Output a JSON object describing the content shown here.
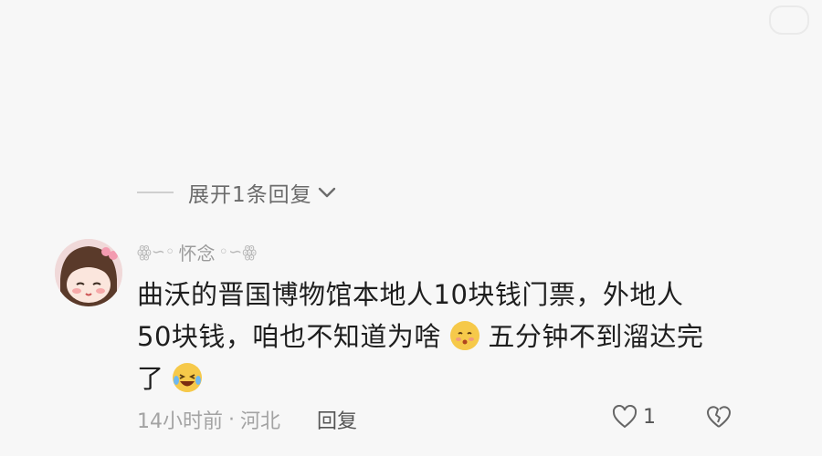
{
  "expand_replies": {
    "label": "展开1条回复"
  },
  "comment": {
    "username": "怀念",
    "line1": "曲沃的晋国博物馆本地人10块钱门票，外地人",
    "line2_before_emoji": "50块钱，咱也不知道为啥",
    "line2_after_emoji": "五分钟不到溜达完",
    "line3": "了",
    "time": "14小时前",
    "separator": "·",
    "location": "河北",
    "reply_label": "回复",
    "like_count": "1"
  },
  "icons": {
    "emoji_1": "kiss-face-emoji",
    "emoji_2": "laughing-tears-emoji",
    "like": "heart-outline-icon",
    "dislike": "broken-heart-icon",
    "expand": "chevron-down-icon"
  },
  "colors": {
    "background": "#f7f7f7",
    "text": "#1e1e1e",
    "muted": "#a3a3a3",
    "emoji": "#f6c94a"
  }
}
